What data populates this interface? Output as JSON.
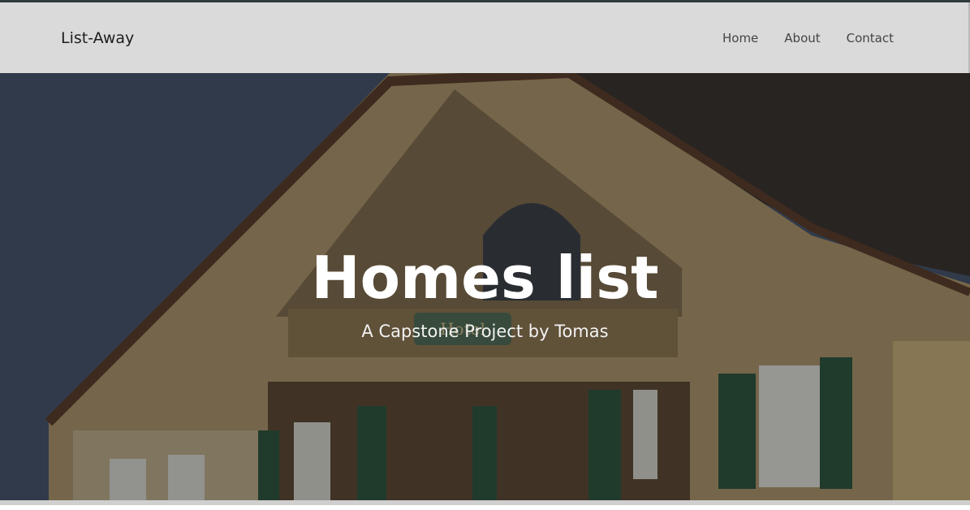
{
  "navbar": {
    "brand": "List-Away",
    "links": [
      {
        "label": "Home"
      },
      {
        "label": "About"
      },
      {
        "label": "Contact"
      }
    ]
  },
  "hero": {
    "title": "Homes list",
    "subtitle": "A Capstone Project by Tomas",
    "image_icon": "chalet-house-photo",
    "sign_text": "Hotel"
  },
  "colors": {
    "navbar_bg": "#dadada",
    "topbar": "#2f3a3a",
    "hero_text": "#ffffff"
  }
}
